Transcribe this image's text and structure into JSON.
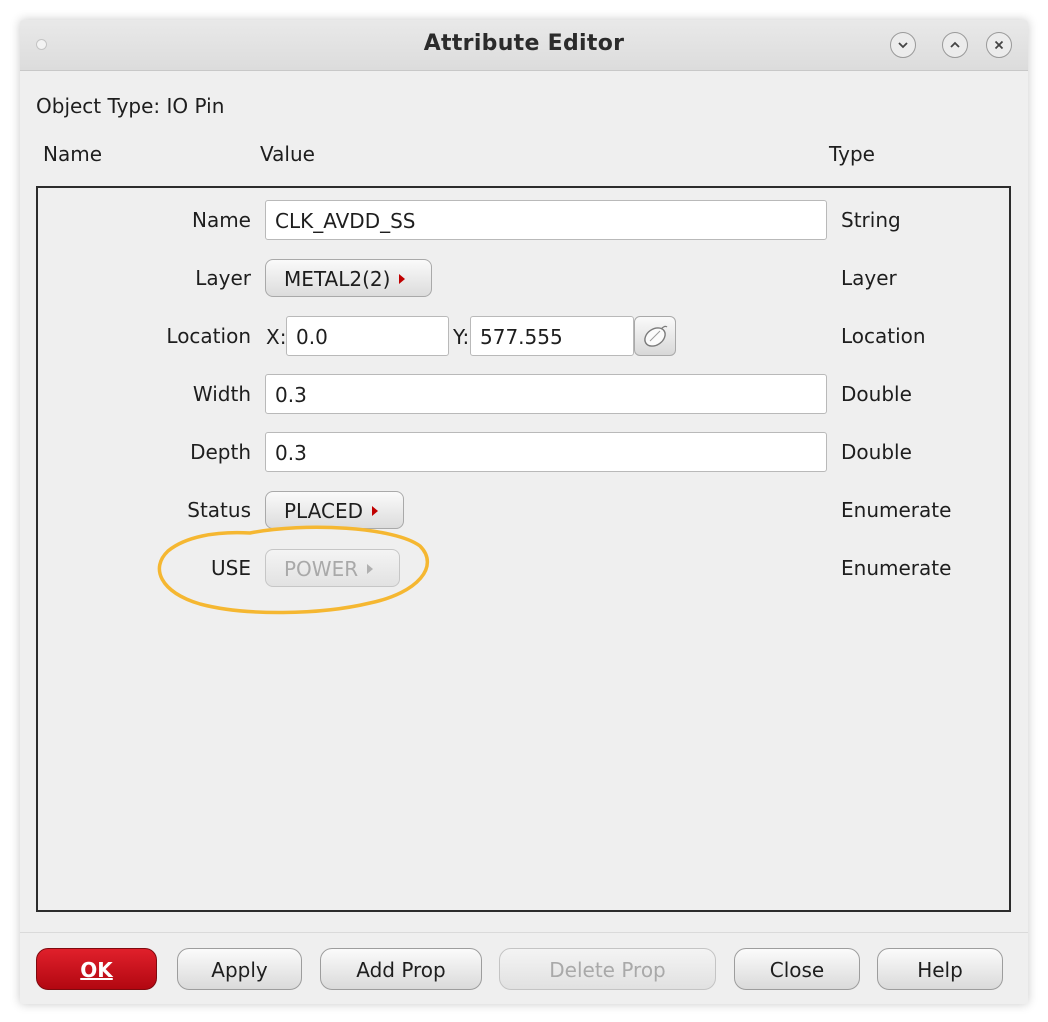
{
  "window": {
    "title": "Attribute Editor",
    "icons": [
      "minimize-chevron-down-icon",
      "maximize-chevron-up-icon",
      "close-x-icon"
    ]
  },
  "object_type": {
    "label": "Object Type:",
    "value": "IO Pin"
  },
  "columns": {
    "name": "Name",
    "value": "Value",
    "type": "Type"
  },
  "rows": {
    "name": {
      "label": "Name",
      "value": "CLK_AVDD_SS",
      "type": "String"
    },
    "layer": {
      "label": "Layer",
      "value": "METAL2(2)",
      "type": "Layer"
    },
    "location": {
      "label": "Location",
      "x_label": "X:",
      "x_value": "0.0",
      "y_label": "Y:",
      "y_value": "577.555",
      "type": "Location"
    },
    "width": {
      "label": "Width",
      "value": "0.3",
      "type": "Double"
    },
    "depth": {
      "label": "Depth",
      "value": "0.3",
      "type": "Double"
    },
    "status": {
      "label": "Status",
      "value": "PLACED",
      "type": "Enumerate"
    },
    "use": {
      "label": "USE",
      "value": "POWER",
      "type": "Enumerate",
      "disabled": true
    }
  },
  "buttons": {
    "ok": "OK",
    "apply": "Apply",
    "add_prop": "Add Prop",
    "delete_prop": "Delete Prop",
    "close": "Close",
    "help": "Help"
  },
  "colors": {
    "ok_button": "#c8101a",
    "cycle_arrow": "#c00000",
    "annotation_circle": "#f5b731",
    "window_background": "#efefef"
  }
}
